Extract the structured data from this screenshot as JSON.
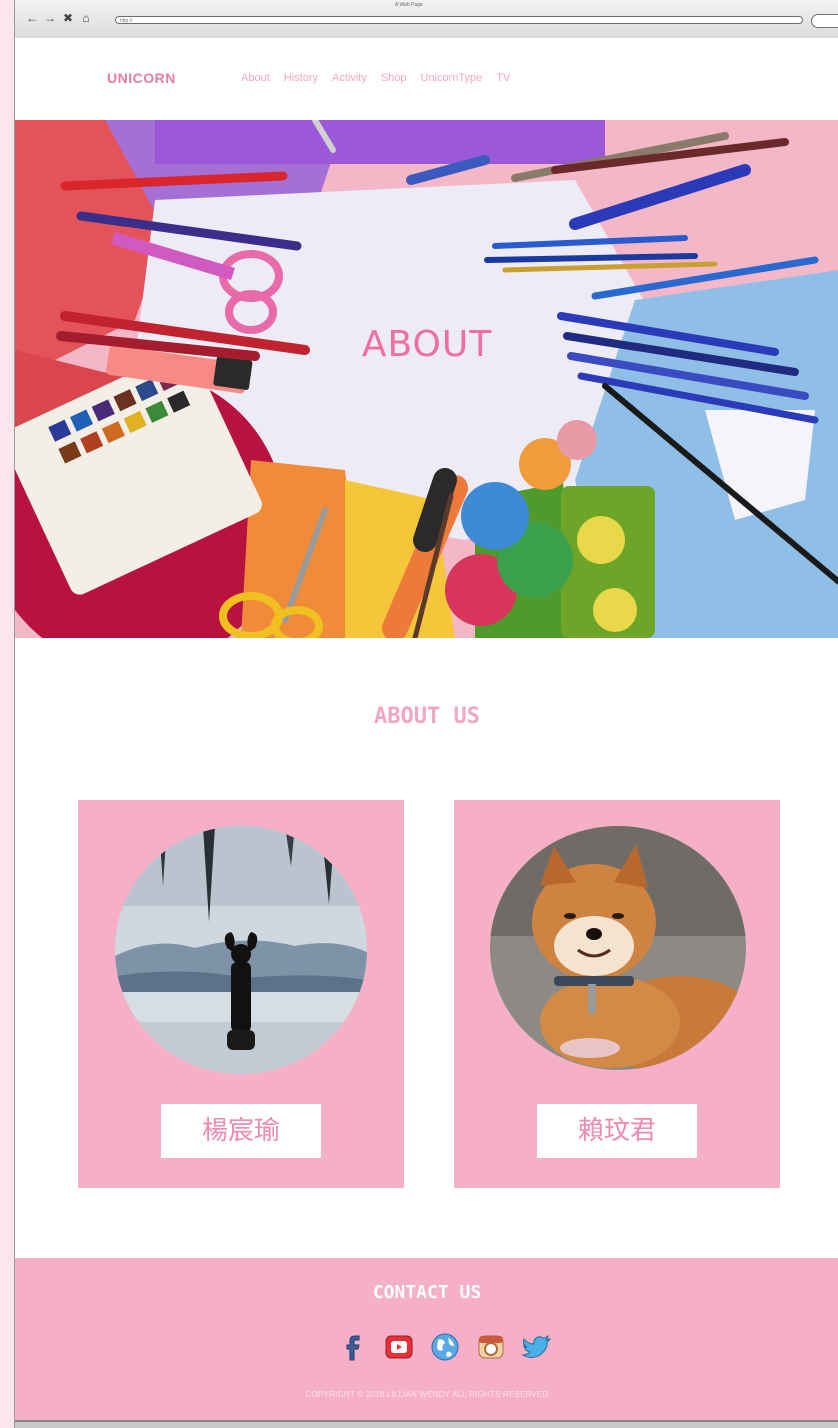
{
  "browser": {
    "window_title": "A Web Page",
    "nav_buttons": [
      "←",
      "→",
      "✖",
      "⌂"
    ],
    "url": "http://"
  },
  "site": {
    "logo": "UNICORN",
    "menu": [
      "About",
      "History",
      "Activity",
      "Shop",
      "UnicornType",
      "TV"
    ]
  },
  "hero": {
    "title": "ABOUT"
  },
  "about": {
    "title": "ABOUT US",
    "members": [
      {
        "name": "楊宸瑜"
      },
      {
        "name": "賴玟君"
      }
    ]
  },
  "footer": {
    "title": "CONTACT US",
    "socials": [
      "facebook-icon",
      "youtube-icon",
      "globe-icon",
      "instagram-icon",
      "twitter-icon"
    ],
    "copyright": "COPYRIGHT © 2018 LILLIAN WENDY ALL RIGHTS RESERVED"
  },
  "colors": {
    "accent": "#ee6fa0",
    "pink_light": "#f5afc6",
    "nav_link": "#f3a6c3"
  }
}
